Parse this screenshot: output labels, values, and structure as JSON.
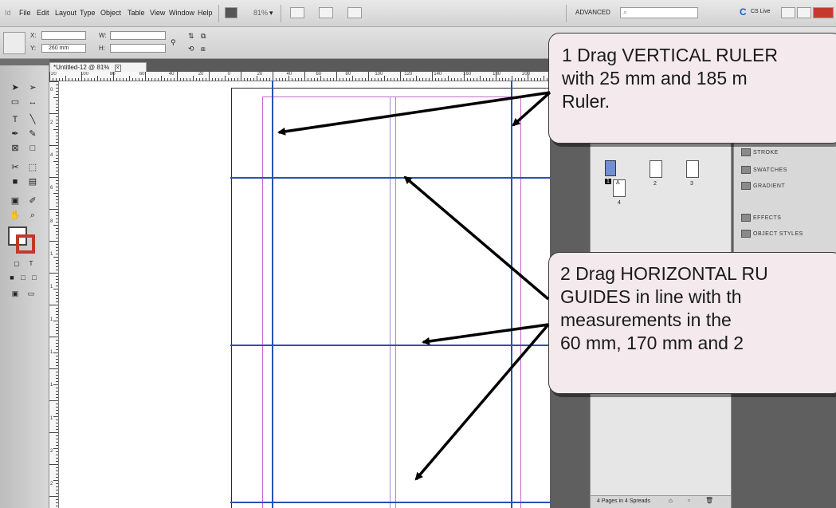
{
  "menubar": {
    "app_icon": "id-logo-icon",
    "items": [
      "File",
      "Edit",
      "Layout",
      "Type",
      "Object",
      "Table",
      "View",
      "Window",
      "Help"
    ],
    "zoom": "81%",
    "workspace": "ADVANCED",
    "cslive": "CS Live"
  },
  "control_panel": {
    "x_label": "X:",
    "y_label": "Y:",
    "y_value": "260 mm",
    "w_label": "W:",
    "h_label": "H:"
  },
  "document": {
    "tab_title": "*Untitled-12 @ 81%",
    "h_ruler_labels": [
      "20",
      "100",
      "80",
      "60",
      "40",
      "20",
      "0",
      "20",
      "40",
      "60",
      "80",
      "100",
      "120",
      "140",
      "160",
      "180",
      "200"
    ],
    "v_ruler_labels": [
      "0",
      "2",
      "4",
      "6",
      "8",
      "1",
      "1",
      "1",
      "1",
      "1",
      "1",
      "2",
      "2"
    ]
  },
  "pages_panel": {
    "page_numbers": [
      "2",
      "3",
      "4"
    ],
    "master_letter": "A",
    "footer": "4 Pages in 4 Spreads"
  },
  "panel_strip": {
    "items": [
      "STROKE",
      "SWATCHES",
      "GRADIENT",
      "EFFECTS",
      "OBJECT STYLES"
    ]
  },
  "callouts": [
    {
      "lines": [
        "1  Drag VERTICAL RULER",
        "    with 25 mm and 185 m",
        "    Ruler."
      ]
    },
    {
      "lines": [
        "2  Drag HORIZONTAL RU",
        "    GUIDES in line with th",
        "    measurements in the",
        "    60 mm, 170 mm and 2"
      ]
    }
  ],
  "colors": {
    "guide": "#2652b4",
    "margin": "#cc66cc",
    "callout_bg": "#f4eaed"
  }
}
